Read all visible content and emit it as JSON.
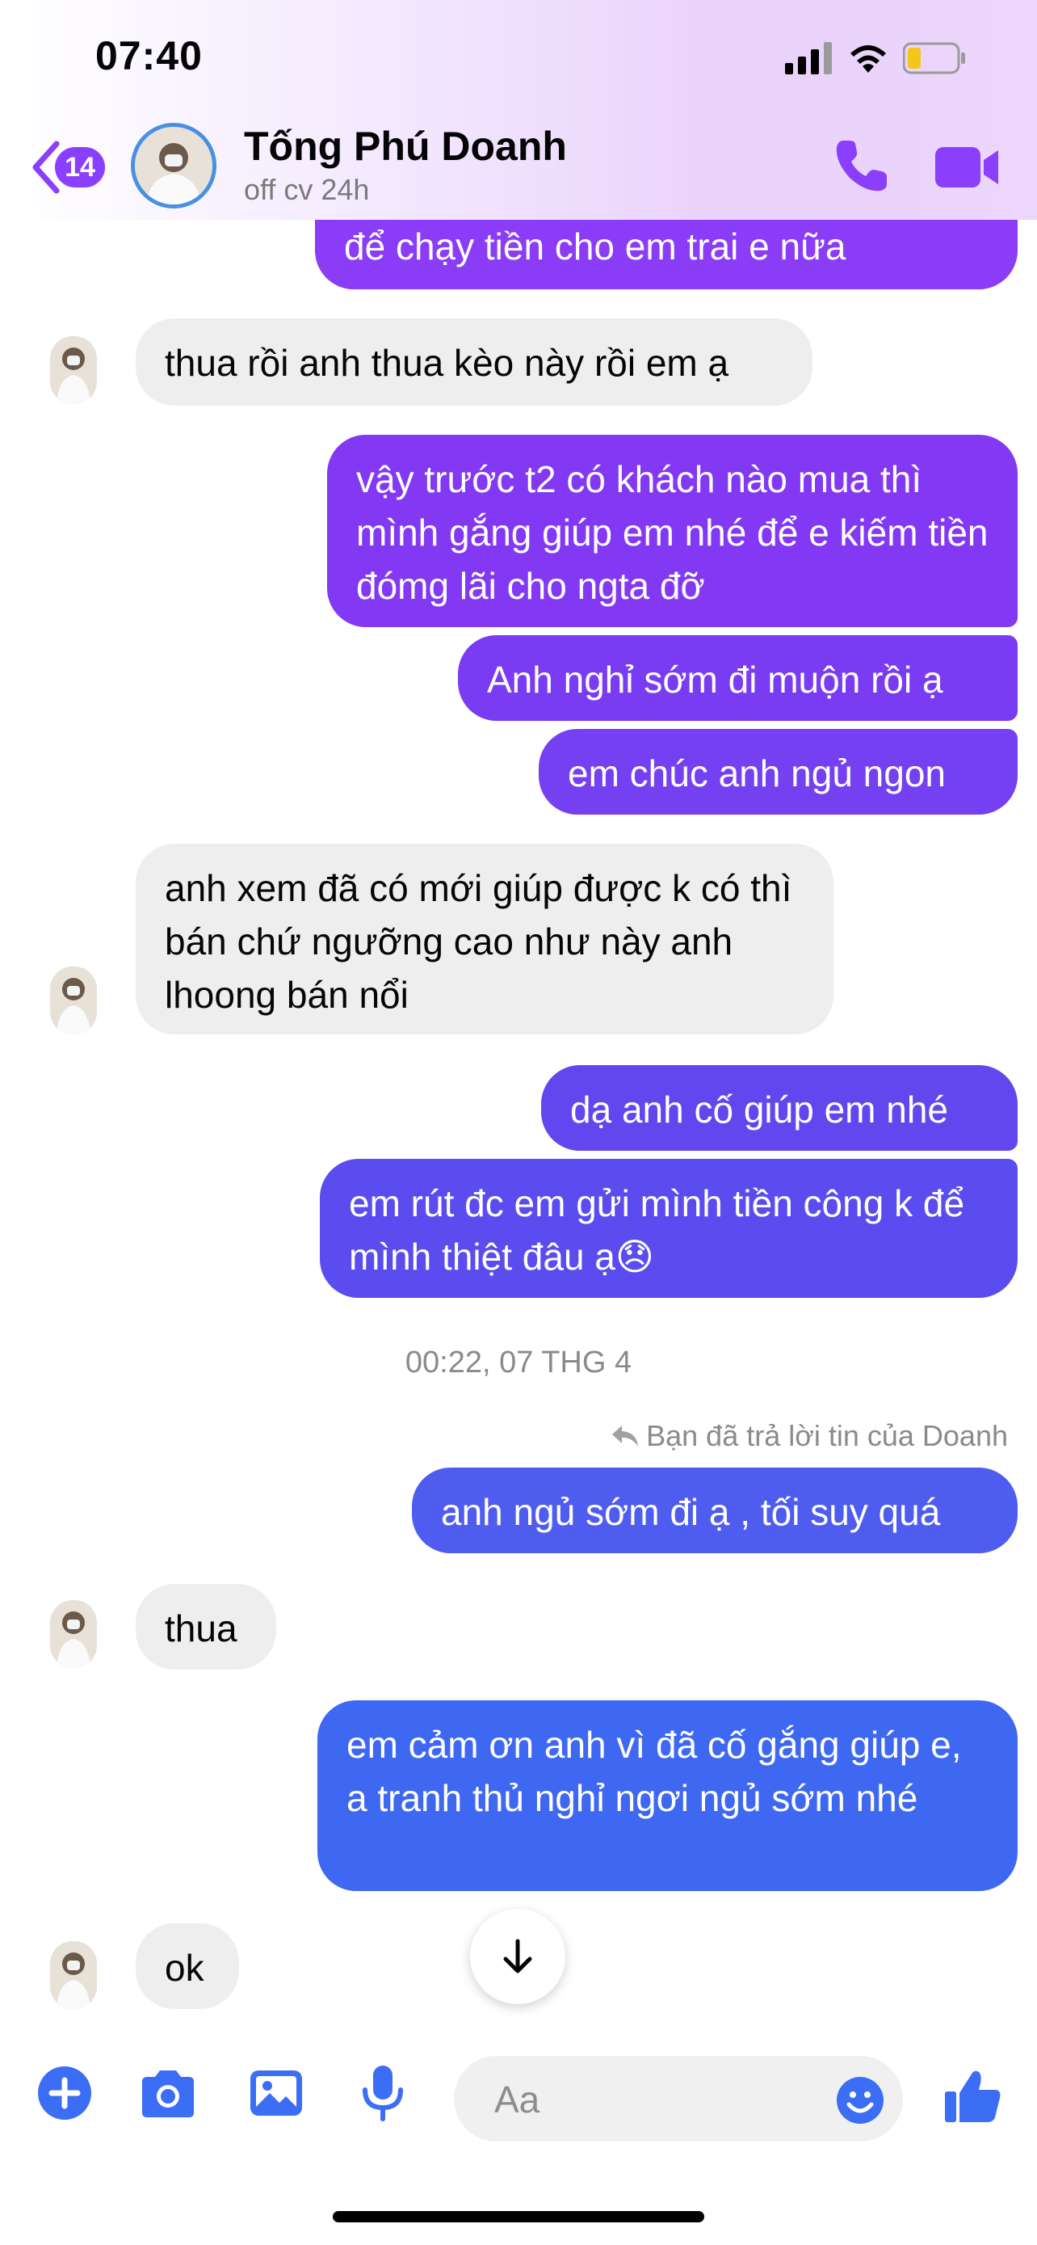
{
  "status_bar": {
    "time": "07:40"
  },
  "header": {
    "back_count": "14",
    "contact_name": "Tống Phú Doanh",
    "contact_status": "off cv 24h"
  },
  "colors": {
    "accent": "#8a3ffc",
    "out_top": "#8b3cf6",
    "out_bottom": "#3b6ef5",
    "incoming": "#eeeeee"
  },
  "messages": [
    {
      "dir": "out",
      "text": "để chạy tiền cho em trai e nữa"
    },
    {
      "dir": "in",
      "text": "thua rồi anh thua kèo này rồi em ạ"
    },
    {
      "dir": "out",
      "text": "vậy trước t2 có khách nào mua thì mình gắng giúp em nhé để e kiếm tiền đómg lãi cho ngta đỡ"
    },
    {
      "dir": "out",
      "text": "Anh nghỉ sớm đi muộn rồi ạ"
    },
    {
      "dir": "out",
      "text": "em chúc anh ngủ ngon"
    },
    {
      "dir": "in",
      "text": "anh xem đã có mới giúp được k có thì bán chứ ngưỡng cao như này anh lhoong bán nổi"
    },
    {
      "dir": "out",
      "text": "dạ anh cố giúp em nhé"
    },
    {
      "dir": "out",
      "text": "em rút đc em gửi mình tiền công k để mình thiệt đâu ạ😞"
    },
    {
      "dir": "out",
      "text": "anh ngủ sớm đi ạ , tối suy quá"
    },
    {
      "dir": "in",
      "text": "thua"
    },
    {
      "dir": "out",
      "text": "em cảm ơn anh vì đã cố gắng giúp e, a tranh thủ nghỉ ngơi ngủ sớm nhé"
    },
    {
      "dir": "in",
      "text": "ok"
    }
  ],
  "timestamp": "00:22, 07 THG 4",
  "reply_note": "Bạn đã trả lời tin của Doanh",
  "composer": {
    "placeholder": "Aa"
  }
}
